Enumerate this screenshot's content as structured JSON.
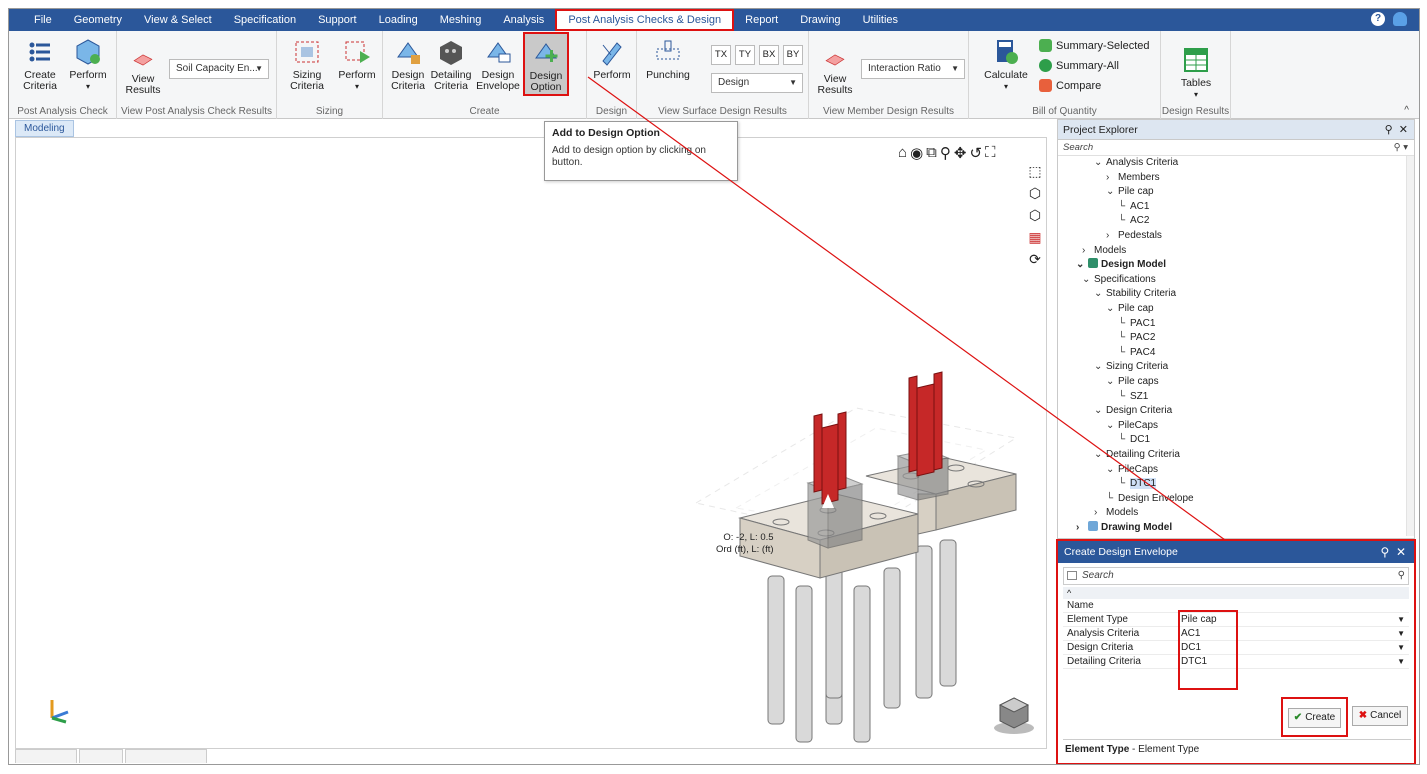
{
  "menu": {
    "items": [
      "File",
      "Geometry",
      "View & Select",
      "Specification",
      "Support",
      "Loading",
      "Meshing",
      "Analysis",
      "Post Analysis Checks & Design",
      "Report",
      "Drawing",
      "Utilities"
    ],
    "active": "Post Analysis Checks & Design"
  },
  "ribbon": {
    "post_analysis_check": {
      "label": "Post Analysis Check",
      "create_criteria": "Create Criteria",
      "perform": "Perform"
    },
    "view_post_results": {
      "label": "View Post Analysis Check Results",
      "view_results": "View Results",
      "dropdown_value": "Soil Capacity En..."
    },
    "sizing": {
      "label": "Sizing",
      "sizing_criteria": "Sizing Criteria",
      "perform": "Perform"
    },
    "create": {
      "label": "Create",
      "design_criteria": "Design Criteria",
      "detailing_criteria": "Detailing Criteria",
      "design_envelope": "Design Envelope",
      "design_option": "Design Option"
    },
    "design": {
      "label": "Design",
      "perform": "Perform"
    },
    "view_surface": {
      "label": "View Surface Design Results",
      "punching": "Punching",
      "buttons": [
        "TX",
        "TY",
        "BX",
        "BY"
      ],
      "dropdown_value": "Design"
    },
    "view_member": {
      "label": "View Member Design Results",
      "view_results": "View Results",
      "dropdown_value": "Interaction Ratio"
    },
    "bill_of_quantity": {
      "label": "Bill of Quantity",
      "calculate": "Calculate",
      "summary_selected": "Summary-Selected",
      "summary_all": "Summary-All",
      "compare": "Compare"
    },
    "design_results": {
      "label": "Design Results",
      "tables": "Tables"
    }
  },
  "tooltip": {
    "title": "Add to Design Option",
    "body": "Add to design option by clicking on button."
  },
  "viewport": {
    "tab": "Modeling",
    "coord_line1": "O: -2, L: 0.5",
    "coord_line2": "Ord (ft), L: (ft)"
  },
  "explorer": {
    "title": "Project Explorer",
    "search_placeholder": "Search",
    "tree": [
      {
        "label": "Analysis Criteria",
        "chev": "v"
      },
      {
        "label": "Members",
        "chev": ">"
      },
      {
        "label": "Pile cap",
        "chev": "v"
      },
      {
        "label": "AC1",
        "chev": ""
      },
      {
        "label": "AC2",
        "chev": ""
      },
      {
        "label": "Pedestals",
        "chev": ">"
      },
      {
        "label": "Models",
        "chev": ">"
      },
      {
        "label": "Design Model",
        "chev": "v"
      },
      {
        "label": "Specifications",
        "chev": "v"
      },
      {
        "label": "Stability Criteria",
        "chev": "v"
      },
      {
        "label": "Pile cap",
        "chev": "v"
      },
      {
        "label": "PAC1",
        "chev": ""
      },
      {
        "label": "PAC2",
        "chev": ""
      },
      {
        "label": "PAC4",
        "chev": ""
      },
      {
        "label": "Sizing Criteria",
        "chev": "v"
      },
      {
        "label": "Pile caps",
        "chev": "v"
      },
      {
        "label": "SZ1",
        "chev": ""
      },
      {
        "label": "Design Criteria",
        "chev": "v"
      },
      {
        "label": "PileCaps",
        "chev": "v"
      },
      {
        "label": "DC1",
        "chev": ""
      },
      {
        "label": "Detailing Criteria",
        "chev": "v"
      },
      {
        "label": "PileCaps",
        "chev": "v"
      },
      {
        "label": "DTC1",
        "chev": ""
      },
      {
        "label": "Design Envelope",
        "chev": ""
      },
      {
        "label": "Models",
        "chev": ">"
      },
      {
        "label": "Drawing Model",
        "chev": ">"
      }
    ]
  },
  "envelope": {
    "title": "Create Design Envelope",
    "search_placeholder": "Search",
    "rows": [
      {
        "key": "Name",
        "value": ""
      },
      {
        "key": "Element Type",
        "value": "Pile cap"
      },
      {
        "key": "Analysis Criteria",
        "value": "AC1"
      },
      {
        "key": "Design Criteria",
        "value": "DC1"
      },
      {
        "key": "Detailing Criteria",
        "value": "DTC1"
      }
    ],
    "create_label": "Create",
    "cancel_label": "Cancel",
    "desc_key": "Element Type",
    "desc_text": " - Element Type"
  },
  "colors": {
    "menu_bg": "#2b579a",
    "highlight_red": "#dd1111",
    "column_red": "#c62828"
  }
}
